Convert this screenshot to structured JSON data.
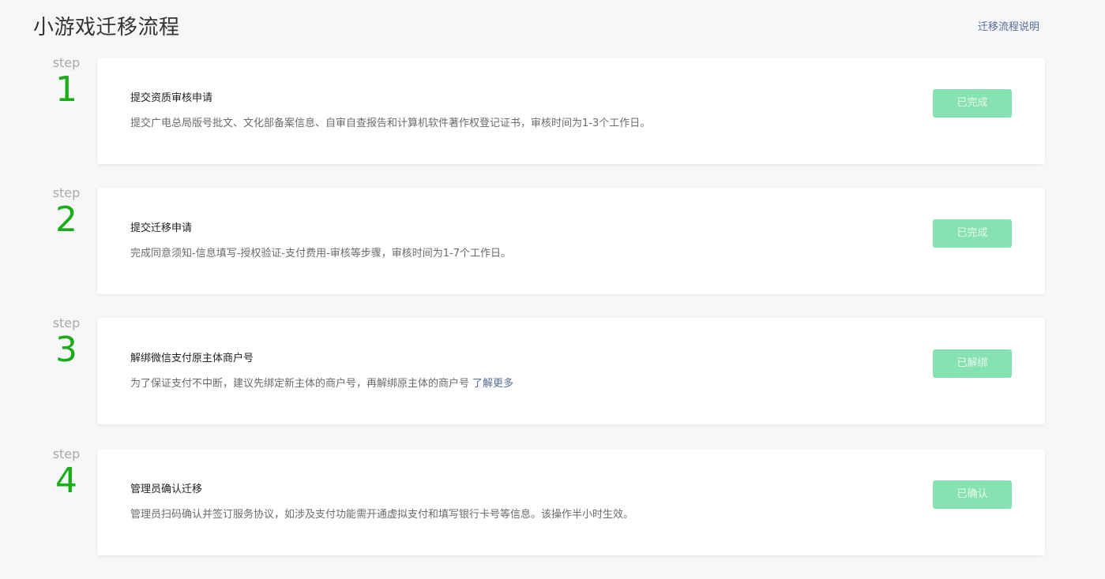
{
  "header": {
    "title": "小游戏迁移流程",
    "help_link": "迁移流程说明"
  },
  "steps": [
    {
      "label": "step",
      "number": "1",
      "title": "提交资质审核申请",
      "description": "提交广电总局版号批文、文化部备案信息、自审自查报告和计算机软件著作权登记证书，审核时间为1-3个工作日。",
      "link": "",
      "button": "已完成"
    },
    {
      "label": "step",
      "number": "2",
      "title": "提交迁移申请",
      "description": "完成同意须知-信息填写-授权验证-支付费用-审核等步骤，审核时间为1-7个工作日。",
      "link": "",
      "button": "已完成"
    },
    {
      "label": "step",
      "number": "3",
      "title": "解绑微信支付原主体商户号",
      "description": "为了保证支付不中断，建议先绑定新主体的商户号，再解绑原主体的商户号",
      "link": "了解更多",
      "button": "已解绑"
    },
    {
      "label": "step",
      "number": "4",
      "title": "管理员确认迁移",
      "description": "管理员扫码确认并签订服务协议，如涉及支付功能需开通虚拟支付和填写银行卡号等信息。该操作半小时生效。",
      "link": "",
      "button": "已确认"
    }
  ],
  "colors": {
    "accent_green": "#1aad19",
    "button_disabled_bg": "#86e2b0",
    "link_blue": "#576b95",
    "page_background": "#f6f7f9"
  }
}
